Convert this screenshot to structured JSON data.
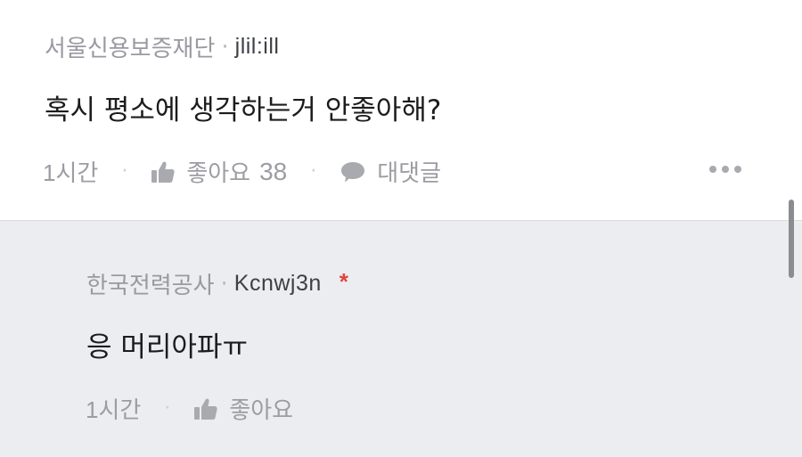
{
  "comment": {
    "company": "서울신용보증재단",
    "separator": "·",
    "nickname": "jlil:ill",
    "text": "혹시 평소에 생각하는거 안좋아해?",
    "time": "1시간",
    "action_sep": "·",
    "like_label": "좋아요",
    "like_count": "38",
    "reply_label": "대댓글"
  },
  "reply": {
    "company": "한국전력공사",
    "separator": "·",
    "nickname": "Kcnwj3n",
    "author_mark": "*",
    "text": "응 머리아파ㅠ",
    "time": "1시간",
    "action_sep": "·",
    "like_label": "좋아요"
  },
  "icons": {
    "like": "thumbs-up-icon",
    "reply": "speech-bubble-icon",
    "more": "more-horizontal-icon"
  },
  "colors": {
    "reply_background": "#ecedf0",
    "author_mark": "#e0453d",
    "secondary_text": "#9c9da3"
  }
}
